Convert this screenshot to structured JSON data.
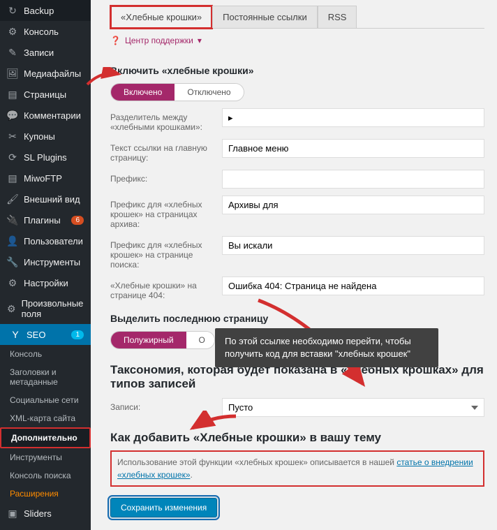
{
  "sidebar": {
    "items": [
      {
        "label": "Backup",
        "icon": "↻"
      },
      {
        "label": "Консоль",
        "icon": "⚙"
      },
      {
        "label": "Записи",
        "icon": "✎"
      },
      {
        "label": "Медиафайлы",
        "icon": "🖼"
      },
      {
        "label": "Страницы",
        "icon": "▤"
      },
      {
        "label": "Комментарии",
        "icon": "💬"
      },
      {
        "label": "Купоны",
        "icon": "✂"
      },
      {
        "label": "SL Plugins",
        "icon": "⟳"
      },
      {
        "label": "MiwoFTP",
        "icon": "▤"
      },
      {
        "label": "Внешний вид",
        "icon": "🖌"
      },
      {
        "label": "Плагины",
        "icon": "🔌",
        "badge": "6"
      },
      {
        "label": "Пользователи",
        "icon": "👤"
      },
      {
        "label": "Инструменты",
        "icon": "🔧"
      },
      {
        "label": "Настройки",
        "icon": "⚙"
      },
      {
        "label": "Произвольные поля",
        "icon": "⚙"
      },
      {
        "label": "SEO",
        "icon": "Y",
        "badge": "1",
        "active": true
      }
    ],
    "subitems": [
      {
        "label": "Консоль"
      },
      {
        "label": "Заголовки и метаданные"
      },
      {
        "label": "Социальные сети"
      },
      {
        "label": "XML-карта сайта"
      },
      {
        "label": "Дополнительно",
        "active": true
      },
      {
        "label": "Инструменты"
      },
      {
        "label": "Консоль поиска"
      },
      {
        "label": "Расширения",
        "highlight": true
      }
    ],
    "sliders": {
      "label": "Sliders",
      "icon": "▣"
    }
  },
  "tabs": [
    {
      "label": "«Хлебные крошки»",
      "active": true,
      "boxed": true
    },
    {
      "label": "Постоянные ссылки"
    },
    {
      "label": "RSS"
    }
  ],
  "support": "Центр поддержки",
  "headings": {
    "enable": "Включить «хлебные крошки»",
    "lastpage": "Выделить последнюю страницу",
    "taxonomy": "Таксономия, которая будет показана в «хлебных крошках» для типов записей",
    "howto": "Как добавить «Хлебные крошки» в вашу тему"
  },
  "toggles": {
    "enabled_on": "Включено",
    "enabled_off": "Отключено",
    "bold_on": "Полужирный",
    "bold_off": "О"
  },
  "fields": {
    "sep_label": "Разделитель между «хлебными крошками»:",
    "sep_val": "▸",
    "home_label": "Текст ссылки на главную страницу:",
    "home_val": "Главное меню",
    "prefix_label": "Префикс:",
    "prefix_val": "",
    "archive_label": "Префикс для «хлебных крошек» на страницах архива:",
    "archive_val": "Архивы для",
    "search_label": "Префикс для «хлебных крошек» на странице поиска:",
    "search_val": "Вы искали",
    "e404_label": "«Хлебные крошки» на странице 404:",
    "e404_val": "Ошибка 404: Страница не найдена",
    "posts_label": "Записи:",
    "posts_val": "Пусто"
  },
  "tooltip": "По этой ссылке необходимо перейти, чтобы получить код для вставки  \"хлебных крошек\"",
  "infobox": {
    "text1": "Использование этой функции «хлебных крошек» описывается в нашей ",
    "link": "статье о внедрении «хлебных крошек»",
    "text2": "."
  },
  "save": "Сохранить изменения"
}
